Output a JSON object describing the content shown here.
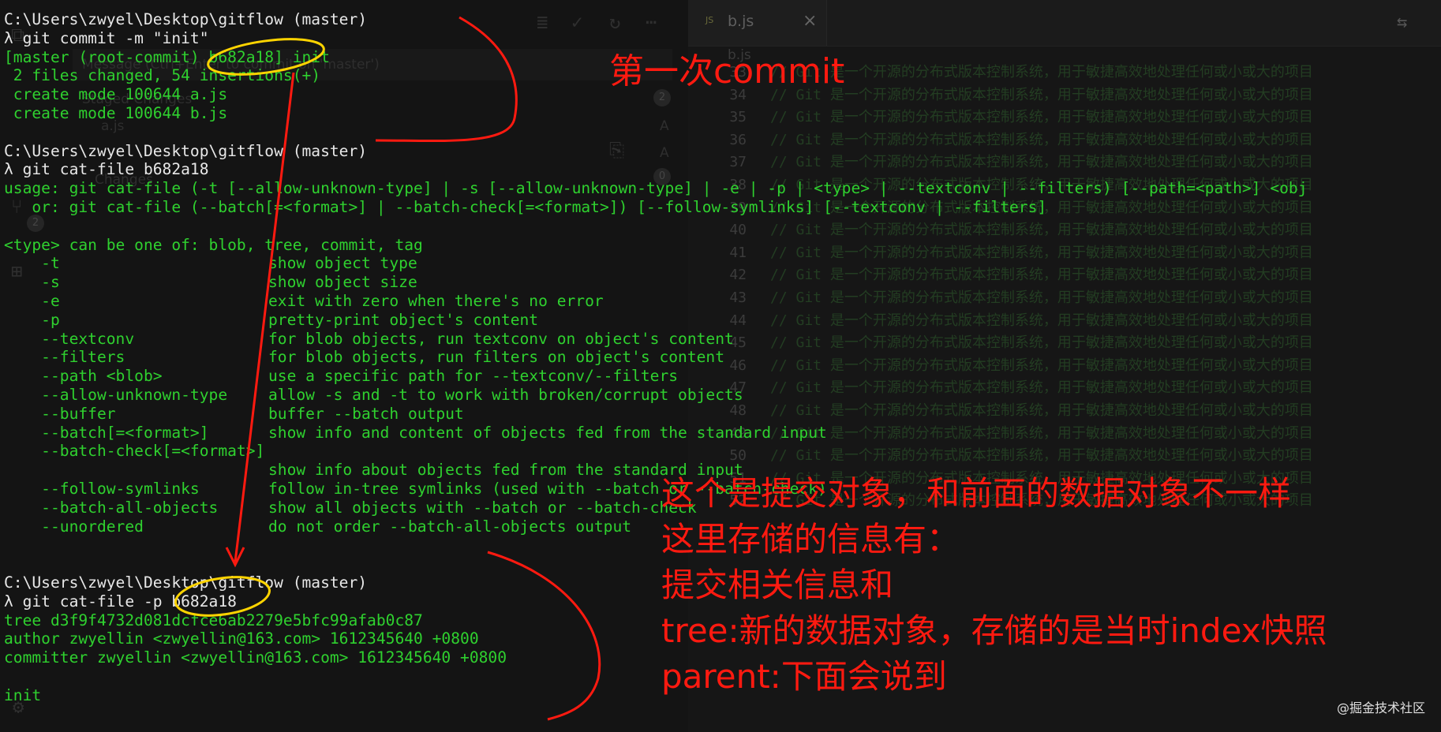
{
  "editor": {
    "tab_label": "b.js",
    "tab_ext": "JS",
    "tab_close": "×",
    "breadcrumb": "b.js",
    "code_text": "// Git 是一个开源的分布式版本控制系统，用于敏捷高效地处理任何或小或大的项目",
    "line_numbers": [
      "33",
      "34",
      "35",
      "36",
      "37",
      "38",
      "39",
      "40",
      "41",
      "42",
      "43",
      "44",
      "45",
      "46",
      "47",
      "48",
      "49",
      "50",
      "51",
      "52"
    ],
    "last_line_suffix": "// ∢"
  },
  "scm_panel": {
    "message_placeholder": "Message (Ctrl+Enter to commit on 'master')",
    "staged_changes": "Staged Changes",
    "staged_count": "2",
    "file_a": "a.js",
    "file_letter_a": "A",
    "changes": "Changes",
    "changes_count": "0",
    "scm_badge": "2"
  },
  "terminal": {
    "lines": [
      {
        "text": "C:\\Users\\zwyel\\Desktop\\gitflow ",
        "suffix": "(master)",
        "kind": "prompt"
      },
      {
        "text": "λ git commit -m \"init\"",
        "kind": "prompt"
      },
      {
        "text": "[master (root-commit) b682a18] init",
        "kind": "out"
      },
      {
        "text": " 2 files changed, 54 insertions(+)",
        "kind": "out"
      },
      {
        "text": " create mode 100644 a.js",
        "kind": "out"
      },
      {
        "text": " create mode 100644 b.js",
        "kind": "out"
      },
      {
        "text": "",
        "kind": "out"
      },
      {
        "text": "C:\\Users\\zwyel\\Desktop\\gitflow ",
        "suffix": "(master)",
        "kind": "prompt"
      },
      {
        "text": "λ git cat-file b682a18",
        "kind": "prompt"
      },
      {
        "text": "usage: git cat-file (-t [--allow-unknown-type] | -s [--allow-unknown-type] | -e | -p | <type> | --textconv | --filters) [--path=<path>] <obj",
        "kind": "out"
      },
      {
        "text": "   or: git cat-file (--batch[=<format>] | --batch-check[=<format>]) [--follow-symlinks] [--textconv | --filters]",
        "kind": "out"
      },
      {
        "text": "",
        "kind": "out"
      },
      {
        "text": "<type> can be one of: blob, tree, commit, tag",
        "kind": "out"
      },
      {
        "text": "    -t",
        "desc": "show object type",
        "kind": "out"
      },
      {
        "text": "    -s",
        "desc": "show object size",
        "kind": "out"
      },
      {
        "text": "    -e",
        "desc": "exit with zero when there's no error",
        "kind": "out"
      },
      {
        "text": "    -p",
        "desc": "pretty-print object's content",
        "kind": "out"
      },
      {
        "text": "    --textconv",
        "desc": "for blob objects, run textconv on object's content",
        "kind": "out"
      },
      {
        "text": "    --filters",
        "desc": "for blob objects, run filters on object's content",
        "kind": "out"
      },
      {
        "text": "    --path <blob>",
        "desc": "use a specific path for --textconv/--filters",
        "kind": "out"
      },
      {
        "text": "    --allow-unknown-type",
        "desc": "allow -s and -t to work with broken/corrupt objects",
        "kind": "out"
      },
      {
        "text": "    --buffer",
        "desc": "buffer --batch output",
        "kind": "out"
      },
      {
        "text": "    --batch[=<format>]",
        "desc": "show info and content of objects fed from the standard input",
        "kind": "out"
      },
      {
        "text": "    --batch-check[=<format>]",
        "kind": "out"
      },
      {
        "text": "",
        "desc": "show info about objects fed from the standard input",
        "kind": "out"
      },
      {
        "text": "    --follow-symlinks",
        "desc": "follow in-tree symlinks (used with --batch or --batch-check)",
        "kind": "out"
      },
      {
        "text": "    --batch-all-objects",
        "desc": "show all objects with --batch or --batch-check",
        "kind": "out"
      },
      {
        "text": "    --unordered",
        "desc": "do not order --batch-all-objects output",
        "kind": "out"
      },
      {
        "text": "",
        "kind": "out"
      },
      {
        "text": "",
        "kind": "out"
      },
      {
        "text": "C:\\Users\\zwyel\\Desktop\\gitflow ",
        "suffix": "(master)",
        "kind": "prompt"
      },
      {
        "text": "λ git cat-file -p b682a18",
        "kind": "prompt"
      },
      {
        "text": "tree d3f9f4732d081dcfce6ab2279e5bfc99afab0c87",
        "kind": "out"
      },
      {
        "text": "author zwyellin <zwyellin@163.com> 1612345640 +0800",
        "kind": "out"
      },
      {
        "text": "committer zwyellin <zwyellin@163.com> 1612345640 +0800",
        "kind": "out"
      },
      {
        "text": "",
        "kind": "out"
      },
      {
        "text": "init",
        "kind": "out"
      }
    ]
  },
  "annotations": {
    "first_commit": "第一次commit",
    "notes": [
      "这个是提交对象，和前面的数据对象不一样",
      "这里存储的信息有：",
      "提交相关信息和",
      "tree:新的数据对象，存储的是当时index快照",
      "parent:下面会说到"
    ],
    "color": "#ff1a10",
    "circle_color": "#ffd400"
  },
  "watermark": "@掘金技术社区"
}
